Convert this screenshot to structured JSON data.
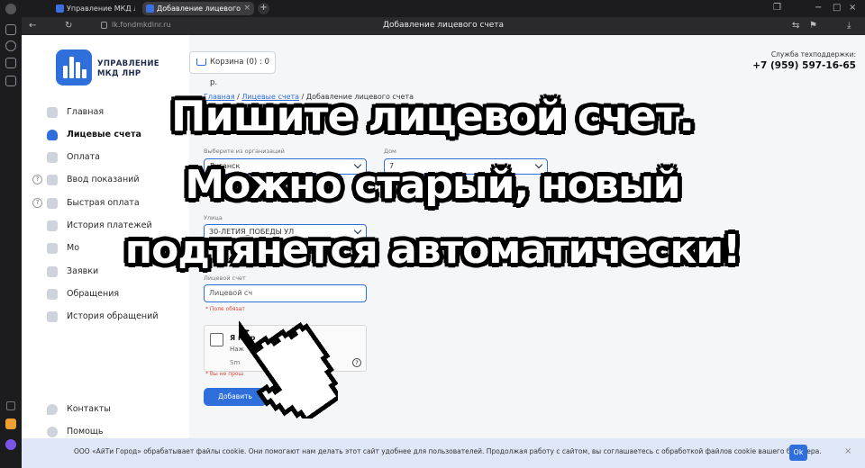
{
  "browser": {
    "tabs": [
      {
        "label": "Управление МКД ЛНР",
        "active": false
      },
      {
        "label": "Добавление лицевого",
        "active": true
      }
    ],
    "url": "lk.fondmkdlnr.ru",
    "page_title": "Добавление лицевого счета"
  },
  "sidebar": {
    "logo_text": "УПРАВЛЕНИЕ\nМКД ЛНР",
    "logo_line1": "УПРАВЛЕНИЕ",
    "logo_line2": "МКД ЛНР",
    "items": [
      {
        "label": "Главная",
        "icon": "home-icon",
        "active": false
      },
      {
        "label": "Лицевые счета",
        "icon": "user-icon",
        "active": true
      },
      {
        "label": "Оплата",
        "icon": "card-icon",
        "active": false
      },
      {
        "label": "Ввод показаний",
        "icon": "meter-icon",
        "active": false,
        "help": "?"
      },
      {
        "label": "Быстрая оплата",
        "icon": "fast-pay-icon",
        "active": false,
        "help": "?"
      },
      {
        "label": "История платежей",
        "icon": "history-icon",
        "active": false
      },
      {
        "label": "Мо",
        "icon": "doc-icon",
        "active": false
      },
      {
        "label": "Заявки",
        "icon": "request-icon",
        "active": false
      },
      {
        "label": "Обращения",
        "icon": "message-icon",
        "active": false
      },
      {
        "label": "История обращений",
        "icon": "message-history-icon",
        "active": false
      }
    ],
    "bottom_items": [
      {
        "label": "Контакты",
        "icon": "location-icon"
      },
      {
        "label": "Помощь",
        "icon": "help-icon"
      }
    ]
  },
  "header": {
    "cart_label": "Корзина (0) : 0 р.",
    "support_label": "Служба техподдержки:",
    "support_phone": "+7 (959) 597-16-65"
  },
  "breadcrumb": {
    "home": "Главная",
    "accounts": "Лицевые счета",
    "current": "Добавление лицевого счета",
    "sep": "/"
  },
  "form": {
    "org_label": "Выберите из организаций",
    "org_value": "Луганск",
    "house_label": "Дом",
    "house_value": "7",
    "street_label": "Улица",
    "street_value": "30-ЛЕТИЯ_ПОБЕДЫ УЛ",
    "account_label": "Лицевой счет",
    "account_placeholder": "Лицевой сч",
    "required_hint": "* Поле обязат",
    "captcha_title": "Я не р",
    "captcha_sub": "Наж",
    "captcha_brand": "Sm",
    "captcha_error": "* Вы не прош",
    "captcha_help": "?",
    "submit_label": "Добавить"
  },
  "cookie": {
    "text": "ООО «АйТи Город» обрабатывает файлы cookie. Они помогают нам делать этот сайт удобнее для пользователей. Продолжая работу с сайтом, вы соглашаетесь с обработкой файлов cookie вашего браузера.",
    "ok": "Ok",
    "close": "×"
  },
  "overlay": {
    "line1": "Пишите лицевой счет.",
    "line2": "Можно старый, новый",
    "line3": "подтянется автоматически!"
  },
  "colors": {
    "accent": "#2f6fdc",
    "error": "#e0463a"
  }
}
